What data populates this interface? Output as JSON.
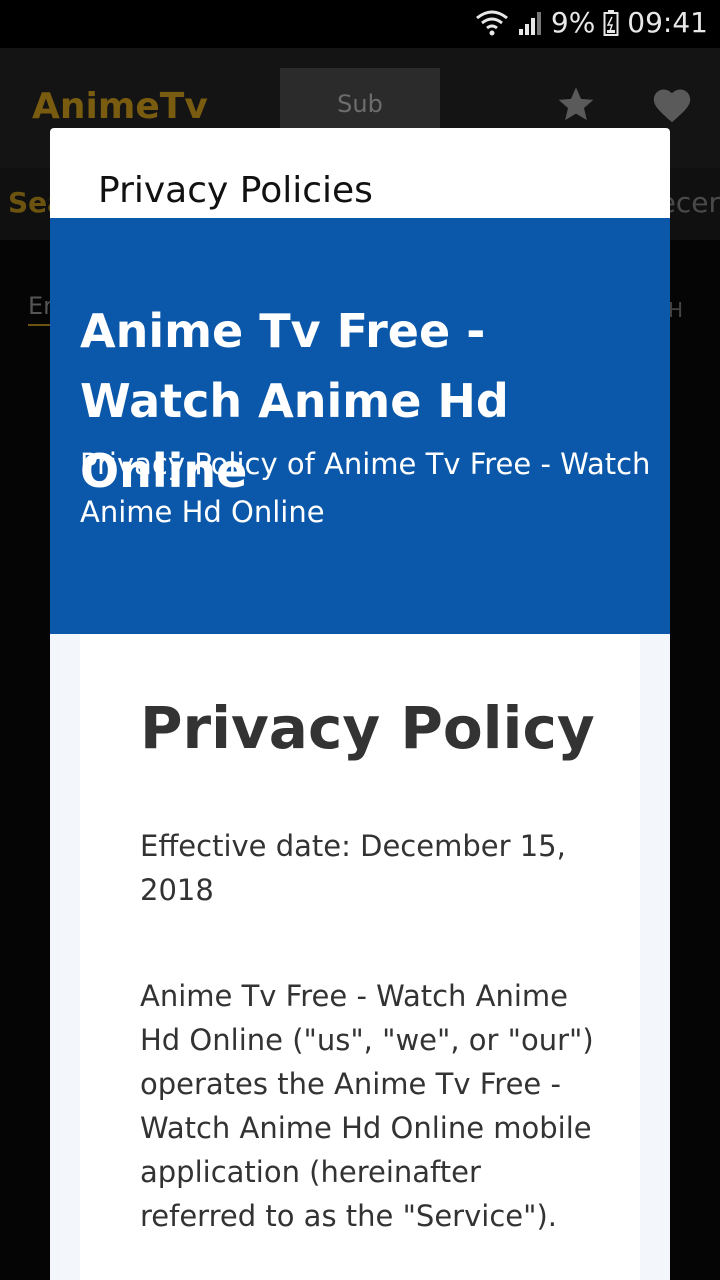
{
  "status_bar": {
    "battery": "9%",
    "time": "09:41",
    "icons": [
      "wifi-icon",
      "signal-icon",
      "battery-icon"
    ]
  },
  "app": {
    "title": "AnimeTv",
    "tab_sub": "Sub",
    "subbar_left_fragment": "Sea",
    "subbar_right_fragment": "ecer",
    "input_fragment": "Er",
    "right_fragment": "H",
    "icons": [
      "star-icon",
      "heart-icon"
    ]
  },
  "dialog": {
    "title": "Privacy Policies",
    "hero": {
      "title": "Anime Tv Free - Watch Anime Hd Online",
      "subtitle": "Privacy Policy of Anime Tv Free - Watch Anime Hd Online"
    },
    "policy": {
      "heading": "Privacy Policy",
      "effective_date": "Effective date: December 15, 2018",
      "paragraph": "Anime Tv Free - Watch Anime Hd Online (\"us\", \"we\", or \"our\") operates the Anime Tv Free - Watch Anime Hd Online mobile application (hereinafter referred to as the \"Service\")."
    }
  },
  "colors": {
    "hero_blue": "#0b58ab",
    "app_title_gold": "#7a5c10",
    "webview_bg": "#f3f6fb"
  }
}
